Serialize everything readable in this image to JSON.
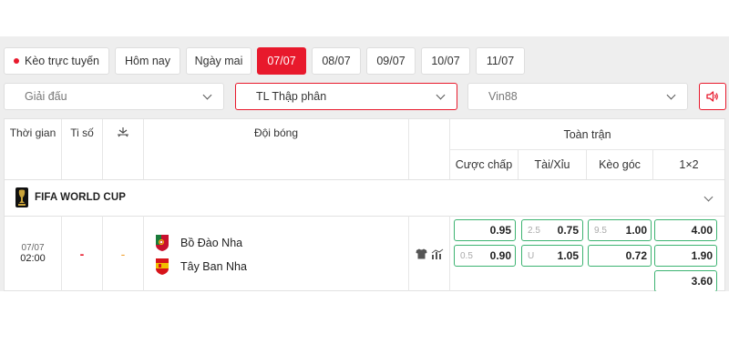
{
  "tabs": [
    {
      "label": "Kèo trực tuyến",
      "active": false
    },
    {
      "label": "Hôm nay",
      "active": false
    },
    {
      "label": "Ngày mai",
      "active": false
    },
    {
      "label": "07/07",
      "active": true
    },
    {
      "label": "08/07",
      "active": false
    },
    {
      "label": "09/07",
      "active": false
    },
    {
      "label": "10/07",
      "active": false
    },
    {
      "label": "11/07",
      "active": false
    }
  ],
  "filters": {
    "league_placeholder": "Giải đấu",
    "odds_format": "TL Thập phân",
    "bookmaker": "Vin88"
  },
  "table": {
    "headers": {
      "time": "Thời gian",
      "score": "Ti số",
      "team": "Đội bóng",
      "full_match": "Toàn trận",
      "handicap": "Cược chấp",
      "over_under": "Tài/Xỉu",
      "corners": "Kèo góc",
      "one_x_two": "1×2"
    },
    "league": {
      "name": "FIFA WORLD CUP"
    },
    "match": {
      "date": "07/07",
      "time": "02:00",
      "score": "-",
      "stat": "-",
      "home_team": "Bồ Đào Nha",
      "away_team": "Tây Ban Nha",
      "handicap": {
        "home": "0.95",
        "away": "0.90",
        "away_line": "0.5"
      },
      "over_under": {
        "line": "2.5",
        "over": "0.75",
        "under_label": "U",
        "under": "1.05"
      },
      "corners": {
        "line": "9.5",
        "home": "1.00",
        "away": "0.72"
      },
      "one_x_two": {
        "home": "4.00",
        "away": "1.90",
        "draw": "3.60"
      }
    }
  },
  "colors": {
    "accent": "#e8192c",
    "odds_border": "#3cb371"
  }
}
